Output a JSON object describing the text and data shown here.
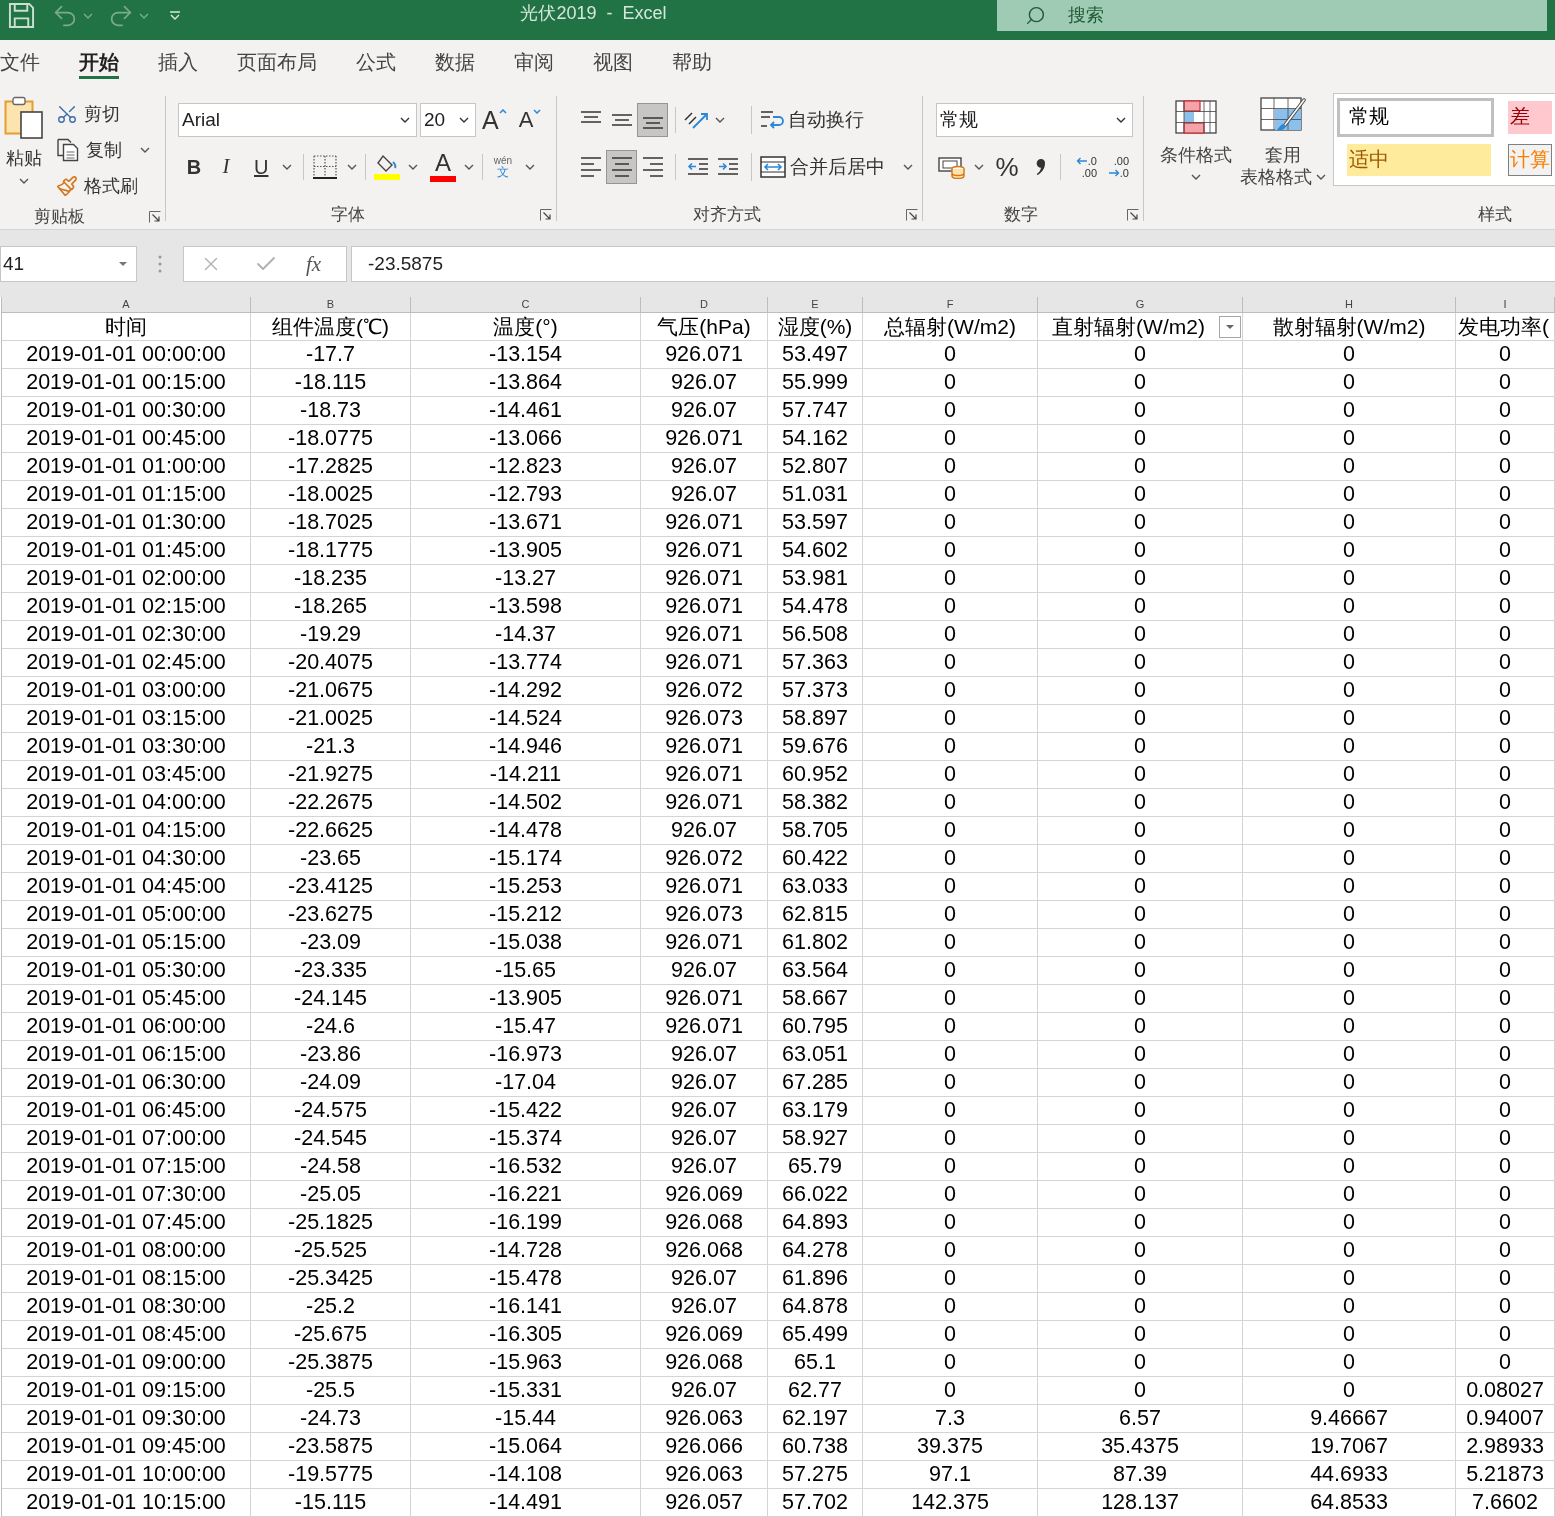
{
  "title_bar": {
    "title": "光伏2019  -  Excel",
    "search": {
      "placeholder": "搜索"
    }
  },
  "ribbon_tabs": [
    {
      "label": "文件",
      "selected": false
    },
    {
      "label": "开始",
      "selected": true
    },
    {
      "label": "插入",
      "selected": false
    },
    {
      "label": "页面布局",
      "selected": false
    },
    {
      "label": "公式",
      "selected": false
    },
    {
      "label": "数据",
      "selected": false
    },
    {
      "label": "审阅",
      "selected": false
    },
    {
      "label": "视图",
      "selected": false
    },
    {
      "label": "帮助",
      "selected": false
    }
  ],
  "ribbon": {
    "clipboard": {
      "label": "剪贴板",
      "paste": "粘贴",
      "cut": "剪切",
      "copy": "复制",
      "format_painter": "格式刷"
    },
    "font": {
      "label": "字体",
      "font_name": "Arial",
      "font_size": "20",
      "grow_font": "A",
      "shrink_font": "A",
      "bold": "B",
      "italic": "I",
      "underline": "U",
      "font_color": "A",
      "phonetic": "wén",
      "phonetic_char": "文"
    },
    "alignment": {
      "label": "对齐方式",
      "vertical": [
        {
          "kind": "top",
          "selected": false
        },
        {
          "kind": "middle",
          "selected": false
        },
        {
          "kind": "bottom",
          "selected": true
        }
      ],
      "horizontal": [
        {
          "kind": "left",
          "selected": false
        },
        {
          "kind": "center",
          "selected": true
        },
        {
          "kind": "right",
          "selected": false
        }
      ],
      "wrap_text": "自动换行",
      "merge_center": "合并后居中"
    },
    "number": {
      "label": "数字",
      "format": "常规",
      "percent": "%",
      "increase_decimal": {
        "top": ".0",
        "bottom": ".00"
      },
      "decrease_decimal": {
        "top": ".00",
        "bottom": ".0"
      }
    },
    "styles": {
      "label": "样式",
      "conditional_formatting": "条件格式",
      "format_as_table": [
        "套用",
        "表格格式"
      ],
      "cell_styles": [
        {
          "label": "常规",
          "kind": "normal",
          "selected": true
        },
        {
          "label": "差",
          "kind": "bad",
          "selected": false
        },
        {
          "label": "适中",
          "kind": "neutral",
          "selected": false
        },
        {
          "label": "计算",
          "kind": "calculation",
          "selected": false
        }
      ]
    }
  },
  "formula_bar": {
    "name_box": "41",
    "function_label": "fx",
    "value": "-23.5875"
  },
  "sheet": {
    "columns": [
      {
        "letter": "A",
        "heading": "时间",
        "filter_button": false
      },
      {
        "letter": "B",
        "heading": "组件温度(℃)",
        "filter_button": false
      },
      {
        "letter": "C",
        "heading": "温度(°)",
        "filter_button": false
      },
      {
        "letter": "D",
        "heading": "气压(hPa)",
        "filter_button": false
      },
      {
        "letter": "E",
        "heading": "湿度(%)",
        "filter_button": false
      },
      {
        "letter": "F",
        "heading": "总辐射(W/m2)",
        "filter_button": false
      },
      {
        "letter": "G",
        "heading": "直射辐射(W/m2)",
        "filter_button": true
      },
      {
        "letter": "H",
        "heading": "散射辐射(W/m2)",
        "filter_button": false
      },
      {
        "letter": "I",
        "heading": "发电功率(",
        "filter_button": false
      }
    ],
    "rows": [
      [
        "2019-01-01 00:00:00",
        "-17.7",
        "-13.154",
        "926.071",
        "53.497",
        "0",
        "0",
        "0",
        "0"
      ],
      [
        "2019-01-01 00:15:00",
        "-18.115",
        "-13.864",
        "926.07",
        "55.999",
        "0",
        "0",
        "0",
        "0"
      ],
      [
        "2019-01-01 00:30:00",
        "-18.73",
        "-14.461",
        "926.07",
        "57.747",
        "0",
        "0",
        "0",
        "0"
      ],
      [
        "2019-01-01 00:45:00",
        "-18.0775",
        "-13.066",
        "926.071",
        "54.162",
        "0",
        "0",
        "0",
        "0"
      ],
      [
        "2019-01-01 01:00:00",
        "-17.2825",
        "-12.823",
        "926.07",
        "52.807",
        "0",
        "0",
        "0",
        "0"
      ],
      [
        "2019-01-01 01:15:00",
        "-18.0025",
        "-12.793",
        "926.07",
        "51.031",
        "0",
        "0",
        "0",
        "0"
      ],
      [
        "2019-01-01 01:30:00",
        "-18.7025",
        "-13.671",
        "926.071",
        "53.597",
        "0",
        "0",
        "0",
        "0"
      ],
      [
        "2019-01-01 01:45:00",
        "-18.1775",
        "-13.905",
        "926.071",
        "54.602",
        "0",
        "0",
        "0",
        "0"
      ],
      [
        "2019-01-01 02:00:00",
        "-18.235",
        "-13.27",
        "926.071",
        "53.981",
        "0",
        "0",
        "0",
        "0"
      ],
      [
        "2019-01-01 02:15:00",
        "-18.265",
        "-13.598",
        "926.071",
        "54.478",
        "0",
        "0",
        "0",
        "0"
      ],
      [
        "2019-01-01 02:30:00",
        "-19.29",
        "-14.37",
        "926.071",
        "56.508",
        "0",
        "0",
        "0",
        "0"
      ],
      [
        "2019-01-01 02:45:00",
        "-20.4075",
        "-13.774",
        "926.071",
        "57.363",
        "0",
        "0",
        "0",
        "0"
      ],
      [
        "2019-01-01 03:00:00",
        "-21.0675",
        "-14.292",
        "926.072",
        "57.373",
        "0",
        "0",
        "0",
        "0"
      ],
      [
        "2019-01-01 03:15:00",
        "-21.0025",
        "-14.524",
        "926.073",
        "58.897",
        "0",
        "0",
        "0",
        "0"
      ],
      [
        "2019-01-01 03:30:00",
        "-21.3",
        "-14.946",
        "926.071",
        "59.676",
        "0",
        "0",
        "0",
        "0"
      ],
      [
        "2019-01-01 03:45:00",
        "-21.9275",
        "-14.211",
        "926.071",
        "60.952",
        "0",
        "0",
        "0",
        "0"
      ],
      [
        "2019-01-01 04:00:00",
        "-22.2675",
        "-14.502",
        "926.071",
        "58.382",
        "0",
        "0",
        "0",
        "0"
      ],
      [
        "2019-01-01 04:15:00",
        "-22.6625",
        "-14.478",
        "926.07",
        "58.705",
        "0",
        "0",
        "0",
        "0"
      ],
      [
        "2019-01-01 04:30:00",
        "-23.65",
        "-15.174",
        "926.072",
        "60.422",
        "0",
        "0",
        "0",
        "0"
      ],
      [
        "2019-01-01 04:45:00",
        "-23.4125",
        "-15.253",
        "926.071",
        "63.033",
        "0",
        "0",
        "0",
        "0"
      ],
      [
        "2019-01-01 05:00:00",
        "-23.6275",
        "-15.212",
        "926.073",
        "62.815",
        "0",
        "0",
        "0",
        "0"
      ],
      [
        "2019-01-01 05:15:00",
        "-23.09",
        "-15.038",
        "926.071",
        "61.802",
        "0",
        "0",
        "0",
        "0"
      ],
      [
        "2019-01-01 05:30:00",
        "-23.335",
        "-15.65",
        "926.07",
        "63.564",
        "0",
        "0",
        "0",
        "0"
      ],
      [
        "2019-01-01 05:45:00",
        "-24.145",
        "-13.905",
        "926.071",
        "58.667",
        "0",
        "0",
        "0",
        "0"
      ],
      [
        "2019-01-01 06:00:00",
        "-24.6",
        "-15.47",
        "926.071",
        "60.795",
        "0",
        "0",
        "0",
        "0"
      ],
      [
        "2019-01-01 06:15:00",
        "-23.86",
        "-16.973",
        "926.07",
        "63.051",
        "0",
        "0",
        "0",
        "0"
      ],
      [
        "2019-01-01 06:30:00",
        "-24.09",
        "-17.04",
        "926.07",
        "67.285",
        "0",
        "0",
        "0",
        "0"
      ],
      [
        "2019-01-01 06:45:00",
        "-24.575",
        "-15.422",
        "926.07",
        "63.179",
        "0",
        "0",
        "0",
        "0"
      ],
      [
        "2019-01-01 07:00:00",
        "-24.545",
        "-15.374",
        "926.07",
        "58.927",
        "0",
        "0",
        "0",
        "0"
      ],
      [
        "2019-01-01 07:15:00",
        "-24.58",
        "-16.532",
        "926.07",
        "65.79",
        "0",
        "0",
        "0",
        "0"
      ],
      [
        "2019-01-01 07:30:00",
        "-25.05",
        "-16.221",
        "926.069",
        "66.022",
        "0",
        "0",
        "0",
        "0"
      ],
      [
        "2019-01-01 07:45:00",
        "-25.1825",
        "-16.199",
        "926.068",
        "64.893",
        "0",
        "0",
        "0",
        "0"
      ],
      [
        "2019-01-01 08:00:00",
        "-25.525",
        "-14.728",
        "926.068",
        "64.278",
        "0",
        "0",
        "0",
        "0"
      ],
      [
        "2019-01-01 08:15:00",
        "-25.3425",
        "-15.478",
        "926.07",
        "61.896",
        "0",
        "0",
        "0",
        "0"
      ],
      [
        "2019-01-01 08:30:00",
        "-25.2",
        "-16.141",
        "926.07",
        "64.878",
        "0",
        "0",
        "0",
        "0"
      ],
      [
        "2019-01-01 08:45:00",
        "-25.675",
        "-16.305",
        "926.069",
        "65.499",
        "0",
        "0",
        "0",
        "0"
      ],
      [
        "2019-01-01 09:00:00",
        "-25.3875",
        "-15.963",
        "926.068",
        "65.1",
        "0",
        "0",
        "0",
        "0"
      ],
      [
        "2019-01-01 09:15:00",
        "-25.5",
        "-15.331",
        "926.07",
        "62.77",
        "0",
        "0",
        "0",
        "0.08027"
      ],
      [
        "2019-01-01 09:30:00",
        "-24.73",
        "-15.44",
        "926.063",
        "62.197",
        "7.3",
        "6.57",
        "9.46667",
        "0.94007"
      ],
      [
        "2019-01-01 09:45:00",
        "-23.5875",
        "-15.064",
        "926.066",
        "60.738",
        "39.375",
        "35.4375",
        "19.7067",
        "2.98933"
      ],
      [
        "2019-01-01 10:00:00",
        "-19.5775",
        "-14.108",
        "926.063",
        "57.275",
        "97.1",
        "87.39",
        "44.6933",
        "5.21873"
      ],
      [
        "2019-01-01 10:15:00",
        "-15.115",
        "-14.491",
        "926.057",
        "57.702",
        "142.375",
        "128.137",
        "64.8533",
        "7.6602"
      ]
    ]
  }
}
